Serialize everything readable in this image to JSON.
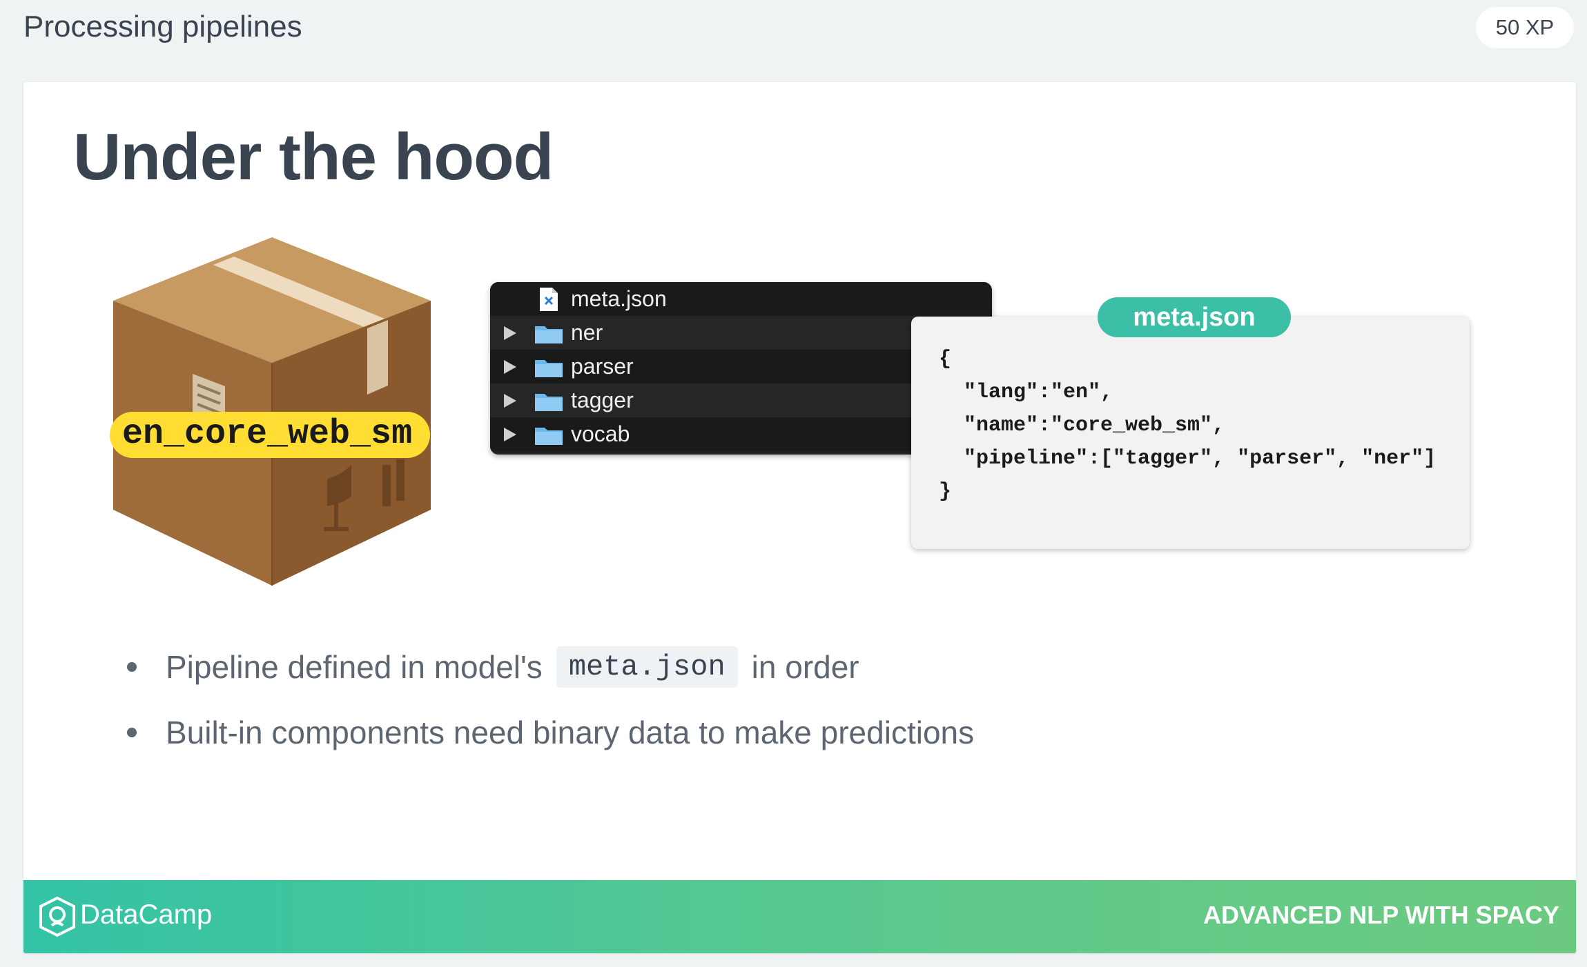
{
  "header": {
    "title": "Processing pipelines",
    "xp_badge": "50 XP"
  },
  "slide": {
    "title": "Under the hood",
    "package": {
      "label": "en_core_web_sm"
    },
    "file_tree": {
      "items": [
        {
          "label": "meta.json",
          "kind": "file",
          "icon": "vscode-file-icon"
        },
        {
          "label": "ner",
          "kind": "folder",
          "icon": "folder-icon"
        },
        {
          "label": "parser",
          "kind": "folder",
          "icon": "folder-icon"
        },
        {
          "label": "tagger",
          "kind": "folder",
          "icon": "folder-icon"
        },
        {
          "label": "vocab",
          "kind": "folder",
          "icon": "folder-icon"
        }
      ]
    },
    "meta_card": {
      "pill": "meta.json",
      "code": "{\n  \"lang\":\"en\",\n  \"name\":\"core_web_sm\",\n  \"pipeline\":[\"tagger\", \"parser\", \"ner\"]\n}"
    },
    "bullets": [
      {
        "before": "Pipeline defined in model's",
        "code": "meta.json",
        "after": "in order"
      },
      {
        "text": "Built-in components need binary data to make predictions"
      }
    ]
  },
  "footer": {
    "brand": "DataCamp",
    "course": "ADVANCED NLP WITH SPACY"
  },
  "colors": {
    "accent_teal": "#3bbfa6",
    "label_yellow": "#ffdd33",
    "title_text": "#3a4451",
    "footer_gradient_start": "#33c3a6",
    "footer_gradient_end": "#6cca80"
  }
}
